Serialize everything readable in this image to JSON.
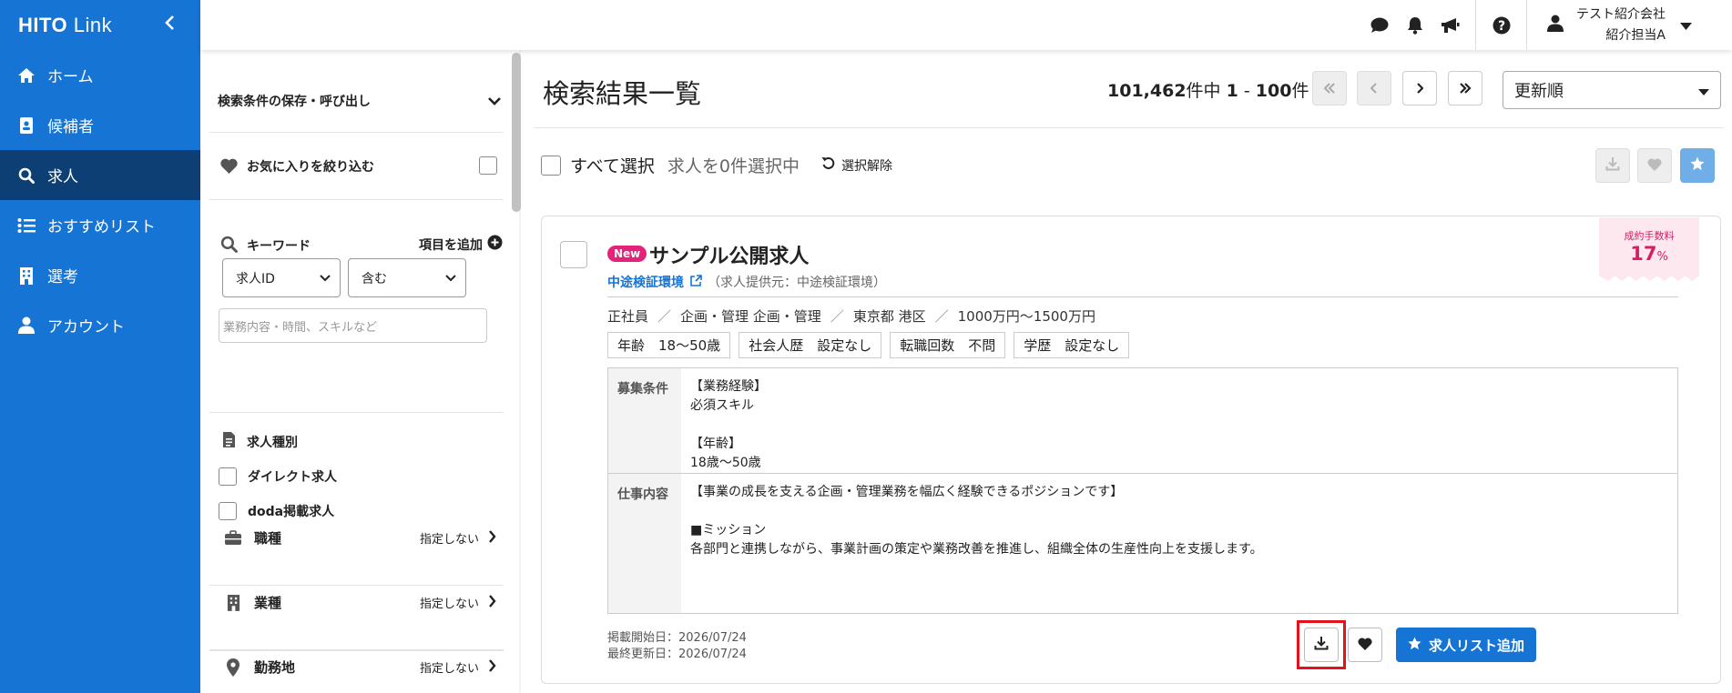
{
  "brand": {
    "name_bold": "HITO",
    "name_light": " Link"
  },
  "sidebar": {
    "items": [
      {
        "label": "ホーム",
        "icon": "home-icon"
      },
      {
        "label": "候補者",
        "icon": "id-badge-icon"
      },
      {
        "label": "求人",
        "icon": "search-icon",
        "active": true
      },
      {
        "label": "おすすめリスト",
        "icon": "list-icon"
      },
      {
        "label": "選考",
        "icon": "building-icon"
      },
      {
        "label": "アカウント",
        "icon": "user-icon"
      }
    ]
  },
  "header": {
    "user_company": "テスト紹介会社",
    "user_name": "紹介担当A"
  },
  "filter": {
    "saved_search_label": "検索条件の保存・呼び出し",
    "favorites_label": "お気に入りを絞り込む",
    "keyword_label": "キーワード",
    "add_field_label": "項目を追加",
    "field_select": "求人ID",
    "match_select": "含む",
    "keyword_placeholder": "業務内容・時間、スキルなど",
    "job_type_label": "求人種別",
    "job_type_options": [
      "ダイレクト求人",
      "doda掲載求人"
    ],
    "categories": [
      {
        "label": "職種",
        "value": "指定しない",
        "icon": "briefcase-icon"
      },
      {
        "label": "業種",
        "value": "指定しない",
        "icon": "building-icon"
      },
      {
        "label": "勤務地",
        "value": "指定しない",
        "icon": "map-pin-icon"
      }
    ]
  },
  "main": {
    "title": "検索結果一覧",
    "total": "101,462",
    "count_mid": "件中",
    "range_start": "1",
    "range_sep": "-",
    "range_end": "100",
    "count_suffix": "件",
    "sort_label": "更新順",
    "select_all_label": "すべて選択",
    "selected_count_text": "求人を0件選択中",
    "deselect_label": "選択解除"
  },
  "job": {
    "badge": "New",
    "title": "サンプル公開求人",
    "company": "中途検証環境",
    "provider": "（求人提供元：中途検証環境）",
    "meta": [
      "正社員",
      "企画・管理 企画・管理",
      "東京都 港区",
      "1000万円〜1500万円"
    ],
    "chips": [
      "年齢　18〜50歳",
      "社会人歴　設定なし",
      "転職回数　不問",
      "学歴　設定なし"
    ],
    "conditions_label": "募集条件",
    "conditions_text": "【業務経験】\n必須スキル\n\n【年齢】\n18歳〜50歳",
    "work_label": "仕事内容",
    "work_text": "【事業の成長を支える企画・管理業務を幅広く経験できるポジションです】\n\n■ミッション\n各部門と連携しながら、事業計画の策定や業務改善を推進し、組織全体の生産性向上を支援します。",
    "published_date": "掲載開始日：2026/07/24",
    "updated_date": "最終更新日：2026/07/24",
    "add_list_label": "求人リスト追加",
    "fee_label": "成約手数料",
    "fee_value": "17",
    "fee_unit": "%"
  },
  "colors": {
    "primary": "#1574d4",
    "sidebar_active": "#0d3f75",
    "accent_pink": "#e4227a",
    "highlight_red": "#e4101c"
  }
}
